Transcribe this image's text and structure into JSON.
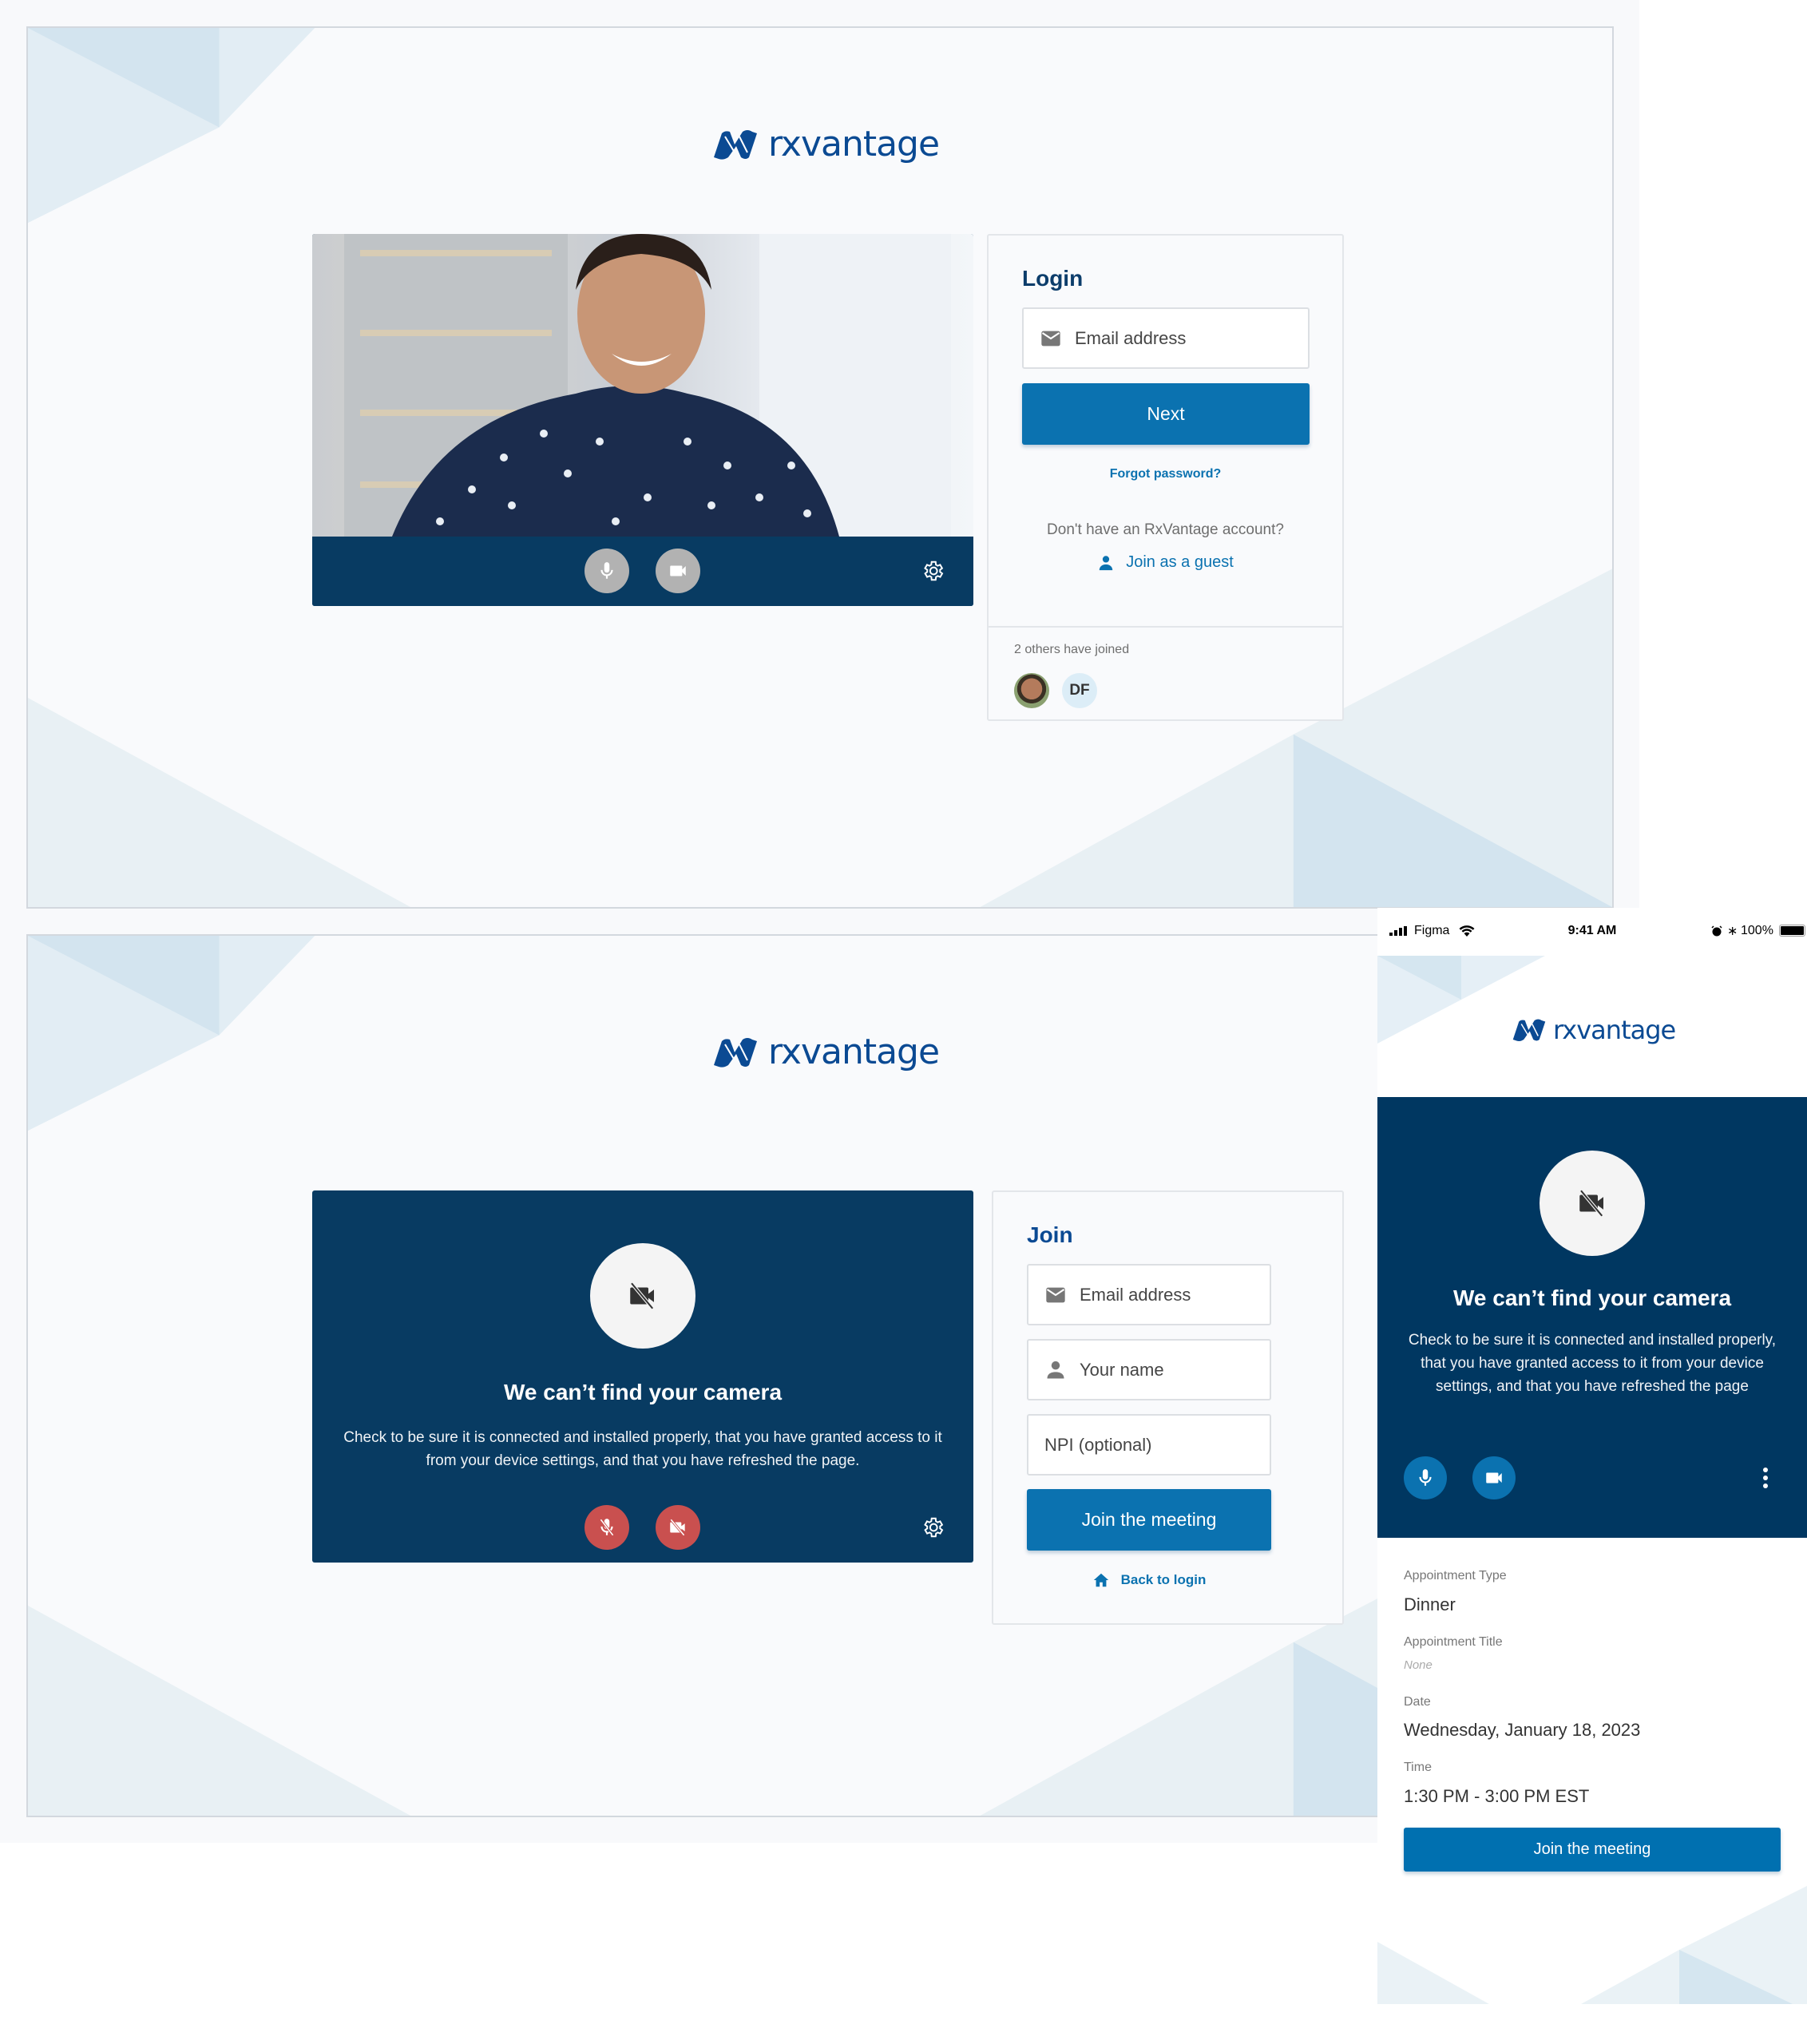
{
  "brand": {
    "name": "rxvantage",
    "trademark": "."
  },
  "colors": {
    "brand_blue": "#0b4a93",
    "primary_button": "#0b72b0",
    "video_panel": "#083b62",
    "muted_red": "#c9504f",
    "device_gray": "#b2b2b2",
    "page_bg": "#f9fafc"
  },
  "login_screen": {
    "video": {
      "controls": [
        {
          "icon": "microphone-icon",
          "state": "enabled"
        },
        {
          "icon": "video-camera-icon",
          "state": "enabled"
        }
      ],
      "settings_icon": "gear-icon"
    },
    "card": {
      "title": "Login",
      "email_placeholder": "Email address",
      "next_label": "Next",
      "forgot_password": "Forgot password?",
      "no_account_text": "Don't have an RxVantage account?",
      "join_guest_label": "Join as a guest",
      "others_joined_text": "2 others have joined",
      "participants": [
        {
          "type": "photo",
          "label": ""
        },
        {
          "type": "initials",
          "label": "DF"
        }
      ]
    }
  },
  "join_screen": {
    "video": {
      "error_title": "We can’t find your camera",
      "error_body": "Check to be sure it is connected and installed properly, that you have granted access to it from your device settings, and that you have refreshed the page.",
      "controls": [
        {
          "icon": "microphone-off-icon",
          "state": "muted"
        },
        {
          "icon": "video-camera-off-icon",
          "state": "muted"
        }
      ],
      "settings_icon": "gear-icon"
    },
    "card": {
      "title": "Join",
      "email_placeholder": "Email address",
      "name_placeholder": "Your name",
      "npi_placeholder": "NPI (optional)",
      "join_label": "Join the meeting",
      "back_label": "Back to login"
    }
  },
  "mobile_screen": {
    "status_bar": {
      "carrier": "Figma",
      "time": "9:41 AM",
      "battery": "100%"
    },
    "video": {
      "error_title": "We can’t find your camera",
      "error_body": "Check to  be sure it is connected and installed properly, that you have granted access to it from your device settings, and that you have refreshed the page"
    },
    "details": [
      {
        "label": "Appointment Type",
        "value": "Dinner",
        "empty": false
      },
      {
        "label": "Appointment Title",
        "value": "None",
        "empty": true
      },
      {
        "label": "Date",
        "value": "Wednesday, January 18, 2023",
        "empty": false
      },
      {
        "label": "Time",
        "value": "1:30 PM - 3:00 PM EST",
        "empty": false
      }
    ],
    "join_label": "Join the meeting"
  }
}
